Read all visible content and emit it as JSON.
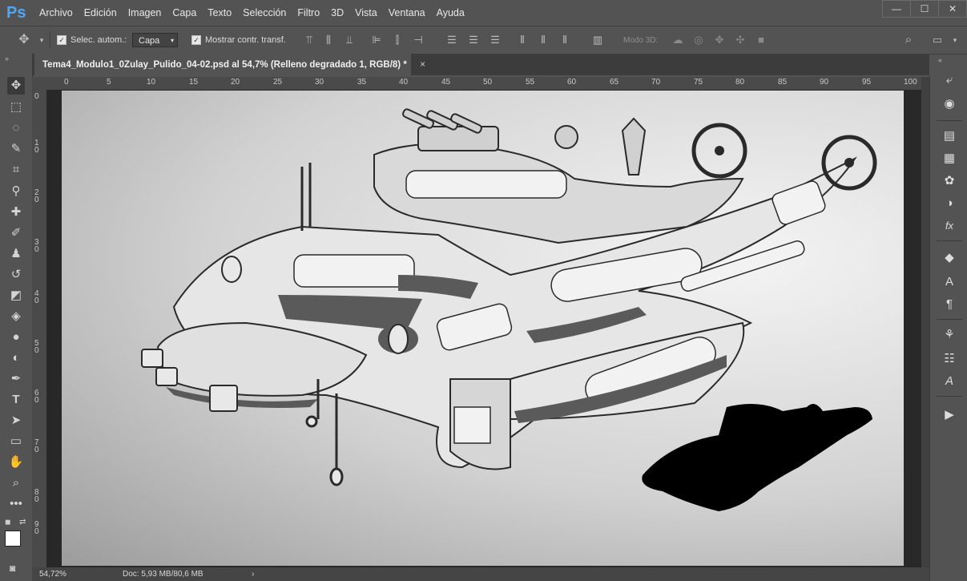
{
  "app": {
    "logo": "Ps"
  },
  "menu": [
    "Archivo",
    "Edición",
    "Imagen",
    "Capa",
    "Texto",
    "Selección",
    "Filtro",
    "3D",
    "Vista",
    "Ventana",
    "Ayuda"
  ],
  "window_controls": {
    "minimize": "—",
    "maximize": "☐",
    "close": "✕"
  },
  "options": {
    "auto_select_label": "Selec. autom.:",
    "auto_select_value": "Capa",
    "show_transform_label": "Mostrar contr. transf.",
    "mode3d_label": "Modo 3D:"
  },
  "document_tab": {
    "title": "Tema4_Modulo1_0Zulay_Pulido_04-02.psd al 54,7% (Relleno degradado 1, RGB/8) *",
    "close": "×"
  },
  "ruler_h": [
    "0",
    "5",
    "10",
    "15",
    "20",
    "25",
    "30",
    "35",
    "40",
    "45",
    "50",
    "55",
    "60",
    "65",
    "70",
    "75",
    "80",
    "85",
    "90",
    "95",
    "100"
  ],
  "ruler_v": [
    "0",
    "1 0",
    "2 0",
    "3 0",
    "4 0",
    "5 0",
    "6 0",
    "7 0",
    "8 0",
    "9 0"
  ],
  "status": {
    "zoom": "54,72%",
    "doc": "Doc: 5,93 MB/80,6 MB",
    "arrow": "›"
  },
  "tools": [
    "move-icon",
    "marquee-icon",
    "lasso-icon",
    "quick-select-icon",
    "crop-icon",
    "eyedropper-icon",
    "healing-icon",
    "brush-icon",
    "stamp-icon",
    "history-brush-icon",
    "eraser-icon",
    "bucket-icon",
    "blur-icon",
    "dodge-icon",
    "pen-icon",
    "type-icon",
    "path-select-icon",
    "rectangle-icon",
    "hand-icon",
    "zoom-icon",
    "more-icon"
  ],
  "colors": {
    "ui_bg": "#535353",
    "dark_bg": "#282828",
    "ps_blue": "#4ea7f5"
  }
}
